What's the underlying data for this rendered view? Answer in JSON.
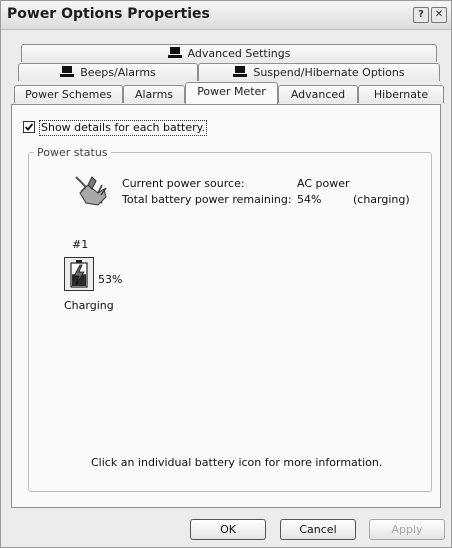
{
  "window": {
    "title": "Power Options Properties"
  },
  "tabs": {
    "row1": [
      {
        "label": "Advanced Settings",
        "icon": "laptop-icon"
      }
    ],
    "row2": [
      {
        "label": "Beeps/Alarms",
        "icon": "laptop-icon"
      },
      {
        "label": "Suspend/Hibernate Options",
        "icon": "laptop-icon"
      }
    ],
    "row3": [
      {
        "label": "Power Schemes"
      },
      {
        "label": "Alarms"
      },
      {
        "label": "Power Meter",
        "active": true
      },
      {
        "label": "Advanced"
      },
      {
        "label": "Hibernate"
      }
    ]
  },
  "power_meter": {
    "show_details_label": "Show details for each battery.",
    "show_details_checked": true,
    "group_label": "Power status",
    "current_source_label": "Current power source:",
    "current_source_value": "AC power",
    "total_remaining_label": "Total battery power remaining:",
    "total_remaining_value": "54%",
    "total_remaining_state": "(charging)",
    "battery": {
      "number": "#1",
      "percent": "53%",
      "level": 0.53,
      "status": "Charging"
    },
    "hint": "Click an individual battery icon for more information."
  },
  "buttons": {
    "ok": "OK",
    "cancel": "Cancel",
    "apply": "Apply"
  },
  "colors": {
    "window_bg": "#ececec",
    "panel_bg": "#fafafa",
    "border": "#8e8e8e"
  }
}
